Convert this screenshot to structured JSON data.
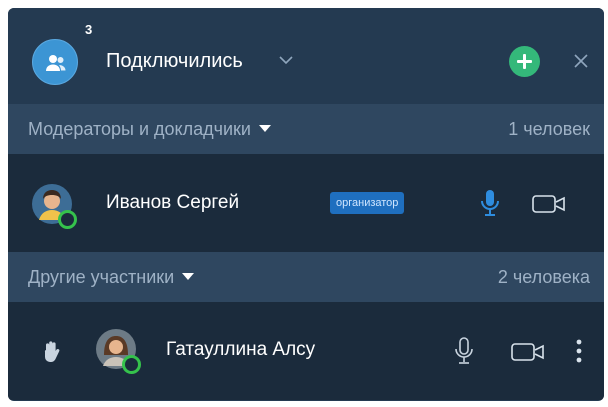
{
  "header": {
    "title": "Подключились",
    "participant_count": "3"
  },
  "sections": {
    "moderators": {
      "label": "Модераторы и докладчики",
      "count": "1 человек"
    },
    "others": {
      "label": "Другие участники",
      "count": "2 человека"
    }
  },
  "participants": [
    {
      "name": "Иванов Сергей",
      "role": "организатор",
      "mic": "active",
      "camera": "off",
      "status": "online"
    },
    {
      "name": "Гатауллина Алсу",
      "hand_raised": true,
      "mic": "inactive",
      "camera": "off",
      "status": "online"
    }
  ],
  "colors": {
    "header_bg": "#243a51",
    "section_bg": "#2f4760",
    "row_bg": "#1b2b3c",
    "accent_blue": "#2e8de0",
    "add_green": "#34b87a",
    "status_green": "#35c24c"
  },
  "icons": [
    "people-icon",
    "chevron-down-icon",
    "plus-icon",
    "close-icon",
    "microphone-icon",
    "camera-icon",
    "hand-icon",
    "more-vertical-icon"
  ]
}
